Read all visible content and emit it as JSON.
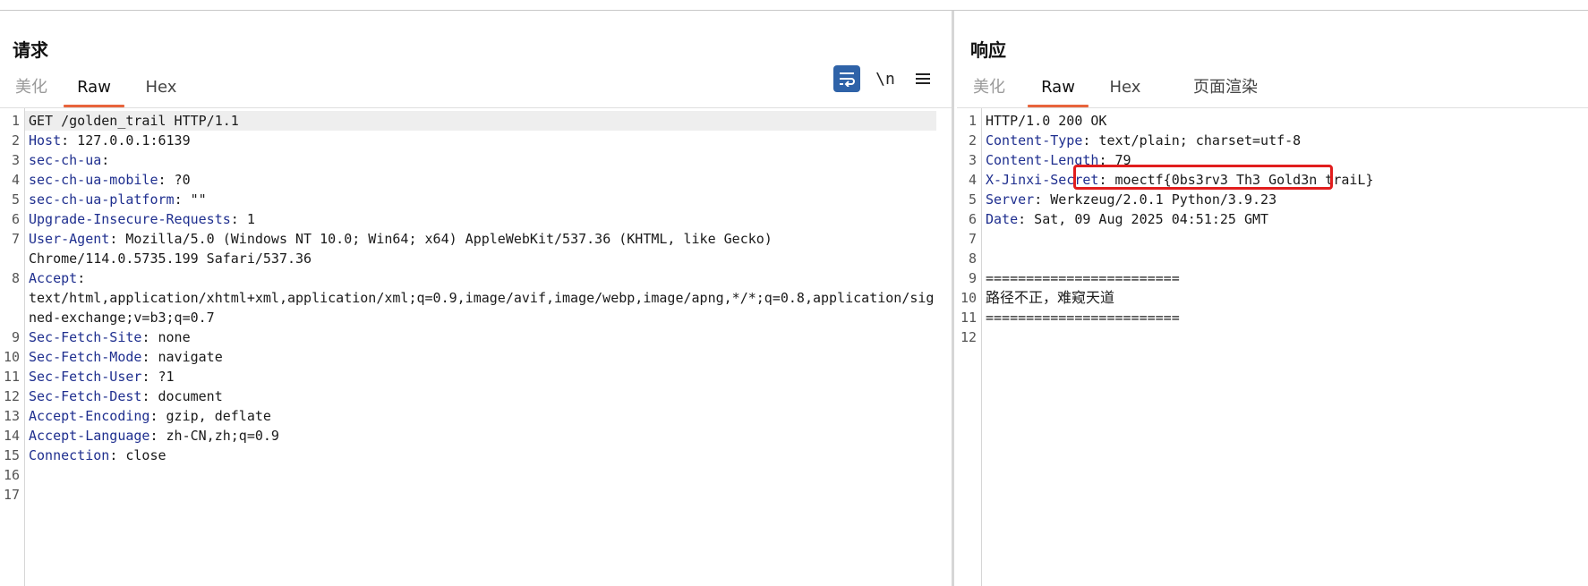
{
  "request": {
    "title": "请求",
    "tabs": [
      "美化",
      "Raw",
      "Hex"
    ],
    "active_tab": "Raw",
    "toolbar": {
      "newline_label": "\\n",
      "wrap_icon": "wrap-lines-icon",
      "menu_icon": "hamburger-menu-icon"
    },
    "line_numbers": [
      "1",
      "2",
      "3",
      "4",
      "5",
      "6",
      "7",
      "8",
      "9",
      "10",
      "11",
      "12",
      "13",
      "14",
      "15",
      "16",
      "17"
    ],
    "lines": {
      "l1": {
        "text": "GET /golden_trail HTTP/1.1"
      },
      "l2": {
        "key": "Host",
        "value": ": 127.0.0.1:6139"
      },
      "l3": {
        "key": "sec-ch-ua",
        "value": ":"
      },
      "l4": {
        "key": "sec-ch-ua-mobile",
        "value": ": ?0"
      },
      "l5": {
        "key": "sec-ch-ua-platform",
        "value": ": \"\""
      },
      "l6": {
        "key": "Upgrade-Insecure-Requests",
        "value": ": 1"
      },
      "l7": {
        "key": "User-Agent",
        "value": ": Mozilla/5.0 (Windows NT 10.0; Win64; x64) AppleWebKit/537.36 (KHTML, like Gecko)",
        "cont": "Chrome/114.0.5735.199 Safari/537.36"
      },
      "l8": {
        "key": "Accept",
        "value": ":",
        "cont1": "text/html,application/xhtml+xml,application/xml;q=0.9,image/avif,image/webp,image/apng,*/*;q=0.8,application/sig",
        "cont2": "ned-exchange;v=b3;q=0.7"
      },
      "l9": {
        "key": "Sec-Fetch-Site",
        "value": ": none"
      },
      "l10": {
        "key": "Sec-Fetch-Mode",
        "value": ": navigate"
      },
      "l11": {
        "key": "Sec-Fetch-User",
        "value": ": ?1"
      },
      "l12": {
        "key": "Sec-Fetch-Dest",
        "value": ": document"
      },
      "l13": {
        "key": "Accept-Encoding",
        "value": ": gzip, deflate"
      },
      "l14": {
        "key": "Accept-Language",
        "value": ": zh-CN,zh;q=0.9"
      },
      "l15": {
        "key": "Connection",
        "value": ": close"
      }
    }
  },
  "response": {
    "title": "响应",
    "tabs": [
      "美化",
      "Raw",
      "Hex",
      "页面渲染"
    ],
    "active_tab": "Raw",
    "line_numbers": [
      "1",
      "2",
      "3",
      "4",
      "5",
      "6",
      "7",
      "8",
      "9",
      "10",
      "11",
      "12"
    ],
    "lines": {
      "l1": {
        "text": "HTTP/1.0 200 OK"
      },
      "l2": {
        "key": "Content-Type",
        "value": ": text/plain; charset=utf-8"
      },
      "l3": {
        "key": "Content-Length",
        "value": ": 79"
      },
      "l4": {
        "key": "X-Jinxi-Secret",
        "value": ": moectf{0bs3rv3_Th3_Gold3n_traiL}"
      },
      "l5": {
        "key": "Server",
        "value": ": Werkzeug/2.0.1 Python/3.9.23"
      },
      "l6": {
        "key": "Date",
        "value": ": Sat, 09 Aug 2025 04:51:25 GMT"
      },
      "l9": {
        "text": "========================"
      },
      "l10": {
        "text": "路径不正，难窥天道"
      },
      "l11": {
        "text": "========================"
      }
    },
    "highlight_color": "#e11d1d"
  },
  "colors": {
    "header_key": "#1f2f8f",
    "tab_underline": "#e8643c",
    "wrap_button": "#2f63a8"
  }
}
